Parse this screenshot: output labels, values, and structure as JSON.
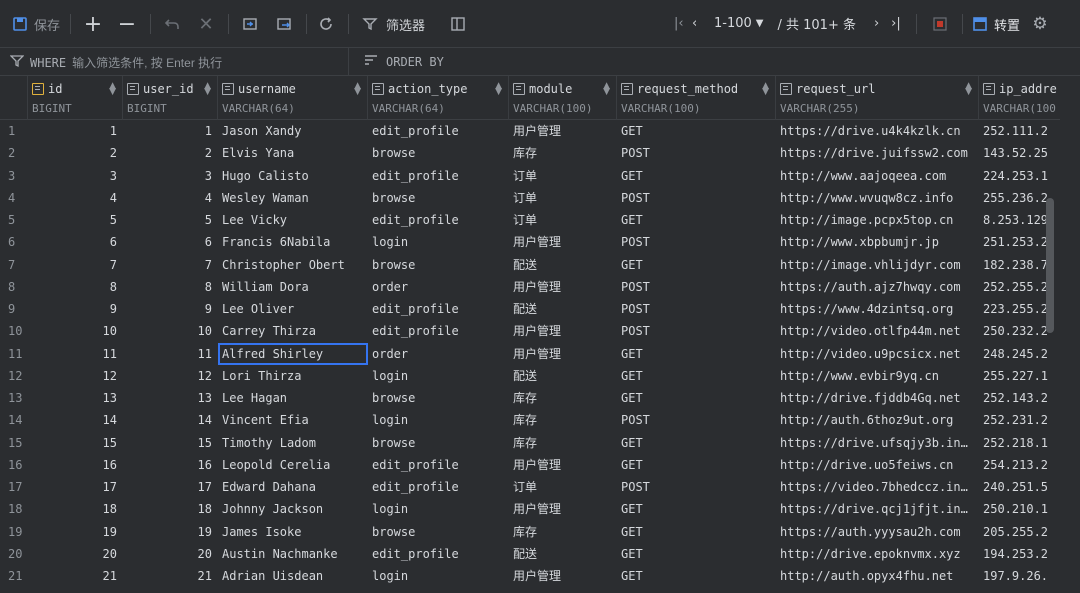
{
  "toolbar": {
    "save_label": "保存",
    "page_range": "1-100",
    "total_label": "/ 共 101+ 条",
    "mode_label": "转置"
  },
  "filter": {
    "where_label": "WHERE",
    "where_placeholder": "输入筛选条件, 按 Enter 执行",
    "order_label": "ORDER BY"
  },
  "columns": [
    {
      "name": "id",
      "type": "BIGINT"
    },
    {
      "name": "user_id",
      "type": "BIGINT"
    },
    {
      "name": "username",
      "type": "VARCHAR(64)"
    },
    {
      "name": "action_type",
      "type": "VARCHAR(64)"
    },
    {
      "name": "module",
      "type": "VARCHAR(100)"
    },
    {
      "name": "request_method",
      "type": "VARCHAR(100)"
    },
    {
      "name": "request_url",
      "type": "VARCHAR(255)"
    },
    {
      "name": "ip_addre",
      "type": "VARCHAR(100"
    }
  ],
  "rows": [
    {
      "rn": "1",
      "id": "1",
      "uid": "1",
      "username": "Jason Xandy",
      "action": "edit_profile",
      "module": "用户管理",
      "method": "GET",
      "url": "https://drive.u4k4kzlk.cn",
      "ip": "252.111.2"
    },
    {
      "rn": "2",
      "id": "2",
      "uid": "2",
      "username": "Elvis Yana",
      "action": "browse",
      "module": "库存",
      "method": "POST",
      "url": "https://drive.juifssw2.com",
      "ip": "143.52.25"
    },
    {
      "rn": "3",
      "id": "3",
      "uid": "3",
      "username": "Hugo Calisto",
      "action": "edit_profile",
      "module": "订单",
      "method": "GET",
      "url": "http://www.aajoqeea.com",
      "ip": "224.253.1"
    },
    {
      "rn": "4",
      "id": "4",
      "uid": "4",
      "username": "Wesley Waman",
      "action": "browse",
      "module": "订单",
      "method": "POST",
      "url": "http://www.wvuqw8cz.info",
      "ip": "255.236.2"
    },
    {
      "rn": "5",
      "id": "5",
      "uid": "5",
      "username": "Lee Vicky",
      "action": "edit_profile",
      "module": "订单",
      "method": "GET",
      "url": "http://image.pcpx5top.cn",
      "ip": "8.253.129"
    },
    {
      "rn": "6",
      "id": "6",
      "uid": "6",
      "username": "Francis 6Nabila",
      "action": "login",
      "module": "用户管理",
      "method": "POST",
      "url": "http://www.xbpbumjr.jp",
      "ip": "251.253.2"
    },
    {
      "rn": "7",
      "id": "7",
      "uid": "7",
      "username": "Christopher Obert",
      "action": "browse",
      "module": "配送",
      "method": "GET",
      "url": "http://image.vhlijdyr.com",
      "ip": "182.238.7"
    },
    {
      "rn": "8",
      "id": "8",
      "uid": "8",
      "username": "William Dora",
      "action": "order",
      "module": "用户管理",
      "method": "POST",
      "url": "https://auth.ajz7hwqy.com",
      "ip": "252.255.2"
    },
    {
      "rn": "9",
      "id": "9",
      "uid": "9",
      "username": "Lee Oliver",
      "action": "edit_profile",
      "module": "配送",
      "method": "POST",
      "url": "https://www.4dzintsq.org",
      "ip": "223.255.2"
    },
    {
      "rn": "10",
      "id": "10",
      "uid": "10",
      "username": "Carrey Thirza",
      "action": "edit_profile",
      "module": "用户管理",
      "method": "POST",
      "url": "http://video.otlfp44m.net",
      "ip": "250.232.2"
    },
    {
      "rn": "11",
      "id": "11",
      "uid": "11",
      "username": "Alfred Shirley",
      "action": "order",
      "module": "用户管理",
      "method": "GET",
      "url": "http://video.u9pcsicx.net",
      "ip": "248.245.2"
    },
    {
      "rn": "12",
      "id": "12",
      "uid": "12",
      "username": "Lori Thirza",
      "action": "login",
      "module": "配送",
      "method": "GET",
      "url": "http://www.evbir9yq.cn",
      "ip": "255.227.1"
    },
    {
      "rn": "13",
      "id": "13",
      "uid": "13",
      "username": "Lee Hagan",
      "action": "browse",
      "module": "库存",
      "method": "GET",
      "url": "http://drive.fjddb4Gq.net",
      "ip": "252.143.2"
    },
    {
      "rn": "14",
      "id": "14",
      "uid": "14",
      "username": "Vincent Efia",
      "action": "login",
      "module": "库存",
      "method": "POST",
      "url": "http://auth.6thoz9ut.org",
      "ip": "252.231.2"
    },
    {
      "rn": "15",
      "id": "15",
      "uid": "15",
      "username": "Timothy Ladom",
      "action": "browse",
      "module": "库存",
      "method": "GET",
      "url": "https://drive.ufsqjy3b.in…",
      "ip": "252.218.1"
    },
    {
      "rn": "16",
      "id": "16",
      "uid": "16",
      "username": "Leopold Cerelia",
      "action": "edit_profile",
      "module": "用户管理",
      "method": "GET",
      "url": "http://drive.uo5feiws.cn",
      "ip": "254.213.2"
    },
    {
      "rn": "17",
      "id": "17",
      "uid": "17",
      "username": "Edward Dahana",
      "action": "edit_profile",
      "module": "订单",
      "method": "POST",
      "url": "https://video.7bhedccz.in…",
      "ip": "240.251.5"
    },
    {
      "rn": "18",
      "id": "18",
      "uid": "18",
      "username": "Johnny Jackson",
      "action": "login",
      "module": "用户管理",
      "method": "GET",
      "url": "https://drive.qcj1jfjt.in…",
      "ip": "250.210.1"
    },
    {
      "rn": "19",
      "id": "19",
      "uid": "19",
      "username": "James Isoke",
      "action": "browse",
      "module": "库存",
      "method": "GET",
      "url": "https://auth.yyysau2h.com",
      "ip": "205.255.2"
    },
    {
      "rn": "20",
      "id": "20",
      "uid": "20",
      "username": "Austin Nachmanke",
      "action": "edit_profile",
      "module": "配送",
      "method": "GET",
      "url": "http://drive.epoknvmx.xyz",
      "ip": "194.253.2"
    },
    {
      "rn": "21",
      "id": "21",
      "uid": "21",
      "username": "Adrian Uisdean",
      "action": "login",
      "module": "用户管理",
      "method": "GET",
      "url": "http://auth.opyx4fhu.net",
      "ip": "197.9.26."
    }
  ]
}
